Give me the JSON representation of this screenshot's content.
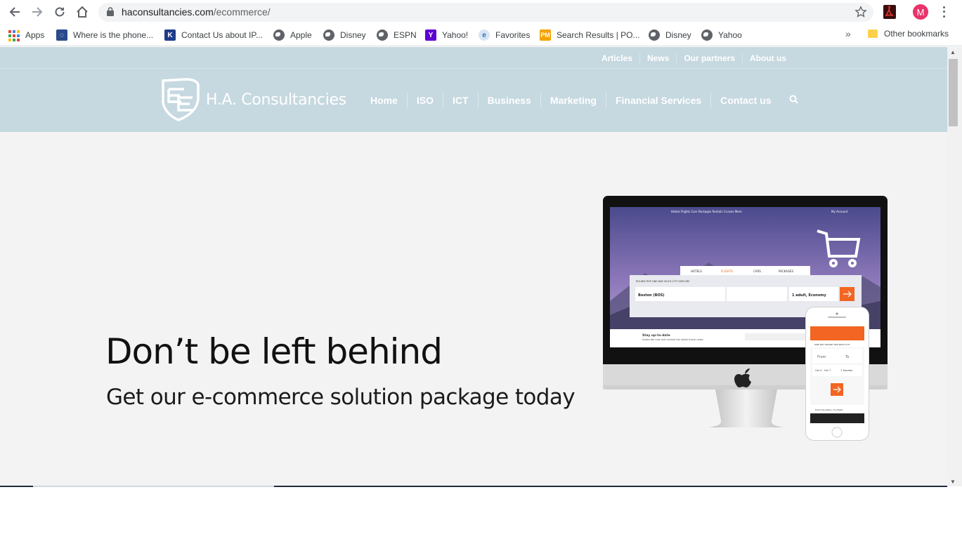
{
  "browser": {
    "url_host": "haconsultancies.com",
    "url_path": "/ecommerce/",
    "profile_initial": "M",
    "bookmarks": [
      {
        "label": "Apps",
        "icon": "apps-grid-icon"
      },
      {
        "label": "Where is the phone...",
        "icon": "site-favicon"
      },
      {
        "label": "Contact Us about IP...",
        "icon": "k-favicon"
      },
      {
        "label": "Apple",
        "icon": "globe-icon"
      },
      {
        "label": "Disney",
        "icon": "globe-icon"
      },
      {
        "label": "ESPN",
        "icon": "globe-icon"
      },
      {
        "label": "Yahoo!",
        "icon": "yahoo-favicon"
      },
      {
        "label": "Favorites",
        "icon": "favorites-icon"
      },
      {
        "label": "Search Results | PO...",
        "icon": "pm-favicon"
      },
      {
        "label": "Disney",
        "icon": "globe-icon"
      },
      {
        "label": "Yahoo",
        "icon": "globe-icon"
      }
    ],
    "overflow": "»",
    "other_bookmarks": "Other bookmarks"
  },
  "site": {
    "top_links": [
      "Articles",
      "News",
      "Our partners",
      "About us"
    ],
    "logo_text": "H.A. Consultancies",
    "nav": [
      "Home",
      "ISO",
      "ICT",
      "Business",
      "Marketing",
      "Financial Services",
      "Contact us"
    ],
    "hero": {
      "title": "Don’t be left behind",
      "subtitle": "Get our e-commerce solution package today"
    },
    "colors": {
      "header_bg": "#c6d8e0",
      "page_bg": "#f3f3f3",
      "accent_orange": "#f26522"
    }
  }
}
